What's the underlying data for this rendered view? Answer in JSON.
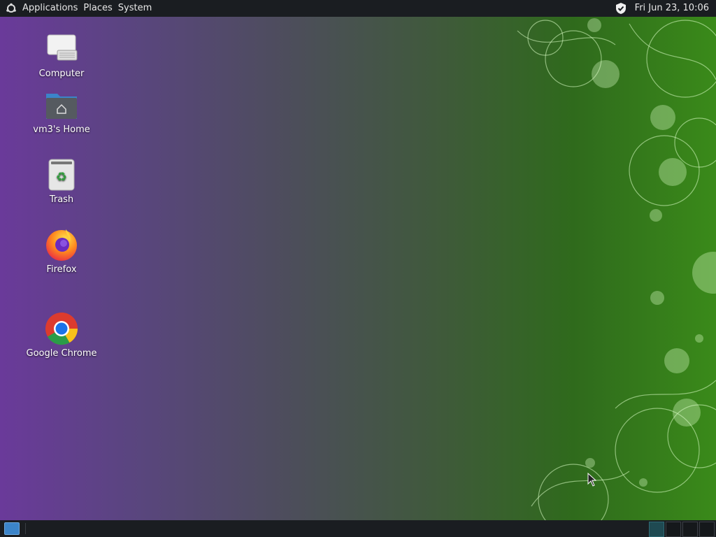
{
  "top_panel": {
    "menus": [
      "Applications",
      "Places",
      "System"
    ],
    "clock": "Fri Jun 23, 10:06",
    "icons": {
      "logo": "gnome-logo-icon",
      "tray": "shield-icon"
    }
  },
  "desktop": {
    "icons": [
      {
        "label": "Computer",
        "icon": "computer-icon"
      },
      {
        "label": "vm3's Home",
        "icon": "home-folder-icon"
      },
      {
        "label": "Trash",
        "icon": "trash-icon"
      },
      {
        "label": "Firefox",
        "icon": "firefox-icon"
      },
      {
        "label": "Google Chrome",
        "icon": "chrome-icon"
      }
    ]
  },
  "bottom_panel": {
    "workspaces": 4,
    "active_workspace": 1
  },
  "colors": {
    "panel": "#1a1d21",
    "accent_blue": "#3b84c9",
    "wallpaper_left": "#6a3a9a",
    "wallpaper_right": "#3a8a1a"
  }
}
